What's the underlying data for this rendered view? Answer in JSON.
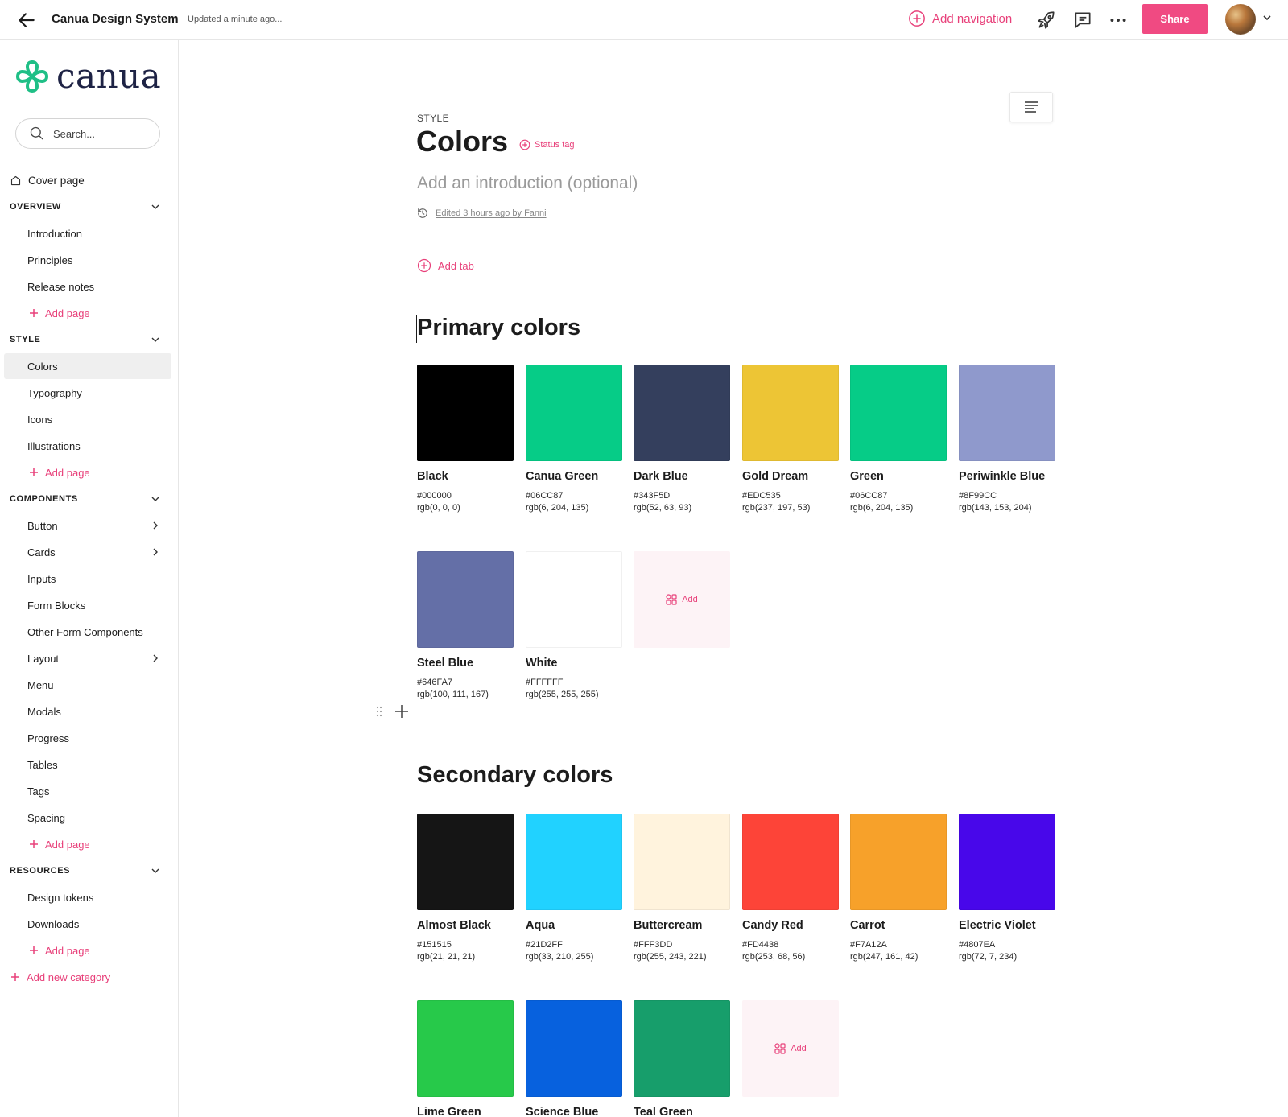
{
  "topbar": {
    "title": "Canua Design System",
    "updated": "Updated a minute ago...",
    "add_navigation": "Add navigation",
    "share": "Share"
  },
  "sidebar": {
    "logo_text": "canua",
    "search_placeholder": "Search...",
    "cover": "Cover page",
    "sections": {
      "overview": "OVERVIEW",
      "style": "STYLE",
      "components": "COMPONENTS",
      "resources": "RESOURCES"
    },
    "overview_items": [
      "Introduction",
      "Principles",
      "Release notes"
    ],
    "style_items": [
      "Colors",
      "Typography",
      "Icons",
      "Illustrations"
    ],
    "components_items": [
      "Button",
      "Cards",
      "Inputs",
      "Form Blocks",
      "Other Form Components",
      "Layout",
      "Menu",
      "Modals",
      "Progress",
      "Tables",
      "Tags",
      "Spacing"
    ],
    "resources_items": [
      "Design tokens",
      "Downloads"
    ],
    "add_page": "Add page",
    "add_category": "Add new category"
  },
  "page": {
    "eyebrow": "STYLE",
    "title": "Colors",
    "status_tag": "Status tag",
    "intro_placeholder": "Add an introduction (optional)",
    "edited": "Edited 3 hours ago by Fanni",
    "add_tab": "Add tab",
    "add_label": "Add"
  },
  "primary": {
    "title": "Primary colors",
    "colors": [
      {
        "name": "Black",
        "hex": "#000000",
        "rgb": "rgb(0, 0, 0)"
      },
      {
        "name": "Canua Green",
        "hex": "#06CC87",
        "rgb": "rgb(6, 204, 135)"
      },
      {
        "name": "Dark Blue",
        "hex": "#343F5D",
        "rgb": "rgb(52, 63, 93)"
      },
      {
        "name": "Gold Dream",
        "hex": "#EDC535",
        "rgb": "rgb(237, 197, 53)"
      },
      {
        "name": "Green",
        "hex": "#06CC87",
        "rgb": "rgb(6, 204, 135)"
      },
      {
        "name": "Periwinkle Blue",
        "hex": "#8F99CC",
        "rgb": "rgb(143, 153, 204)"
      },
      {
        "name": "Steel Blue",
        "hex": "#646FA7",
        "rgb": "rgb(100, 111, 167)"
      },
      {
        "name": "White",
        "hex": "#FFFFFF",
        "rgb": "rgb(255, 255, 255)"
      }
    ]
  },
  "secondary": {
    "title": "Secondary colors",
    "colors": [
      {
        "name": "Almost Black",
        "hex": "#151515",
        "rgb": "rgb(21, 21, 21)"
      },
      {
        "name": "Aqua",
        "hex": "#21D2FF",
        "rgb": "rgb(33, 210, 255)"
      },
      {
        "name": "Buttercream",
        "hex": "#FFF3DD",
        "rgb": "rgb(255, 243, 221)"
      },
      {
        "name": "Candy Red",
        "hex": "#FD4438",
        "rgb": "rgb(253, 68, 56)"
      },
      {
        "name": "Carrot",
        "hex": "#F7A12A",
        "rgb": "rgb(247, 161, 42)"
      },
      {
        "name": "Electric Violet",
        "hex": "#4807EA",
        "rgb": "rgb(72, 7, 234)"
      },
      {
        "name": "Lime Green",
        "fill": "#27C94A"
      },
      {
        "name": "Science Blue",
        "fill": "#0761DE"
      },
      {
        "name": "Teal Green",
        "fill": "#179E6B"
      }
    ]
  },
  "theme": {
    "accent": "#F04A82",
    "link": "#E8407A",
    "logo_green": "#1FBF86",
    "logo_navy": "#1E2345"
  }
}
